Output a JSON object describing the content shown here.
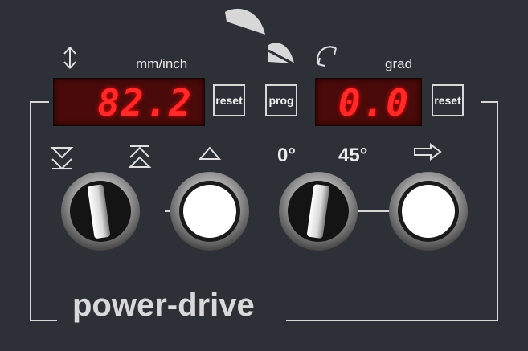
{
  "length_display": {
    "unit_label": "mm/inch",
    "value": "82.2",
    "icon": "vertical-arrows-icon"
  },
  "angle_display": {
    "unit_label": "grad",
    "value": "0.0",
    "icon": "rotate-arrows-icon"
  },
  "buttons": {
    "reset_length": "reset",
    "prog": "prog",
    "reset_angle": "reset"
  },
  "labels": {
    "angle_0": "0°",
    "angle_45": "45°"
  },
  "brand": "power-drive",
  "colors": {
    "panel": "#2e3038",
    "display_bg": "#4a0a0a",
    "led": "#ff2a2a"
  }
}
